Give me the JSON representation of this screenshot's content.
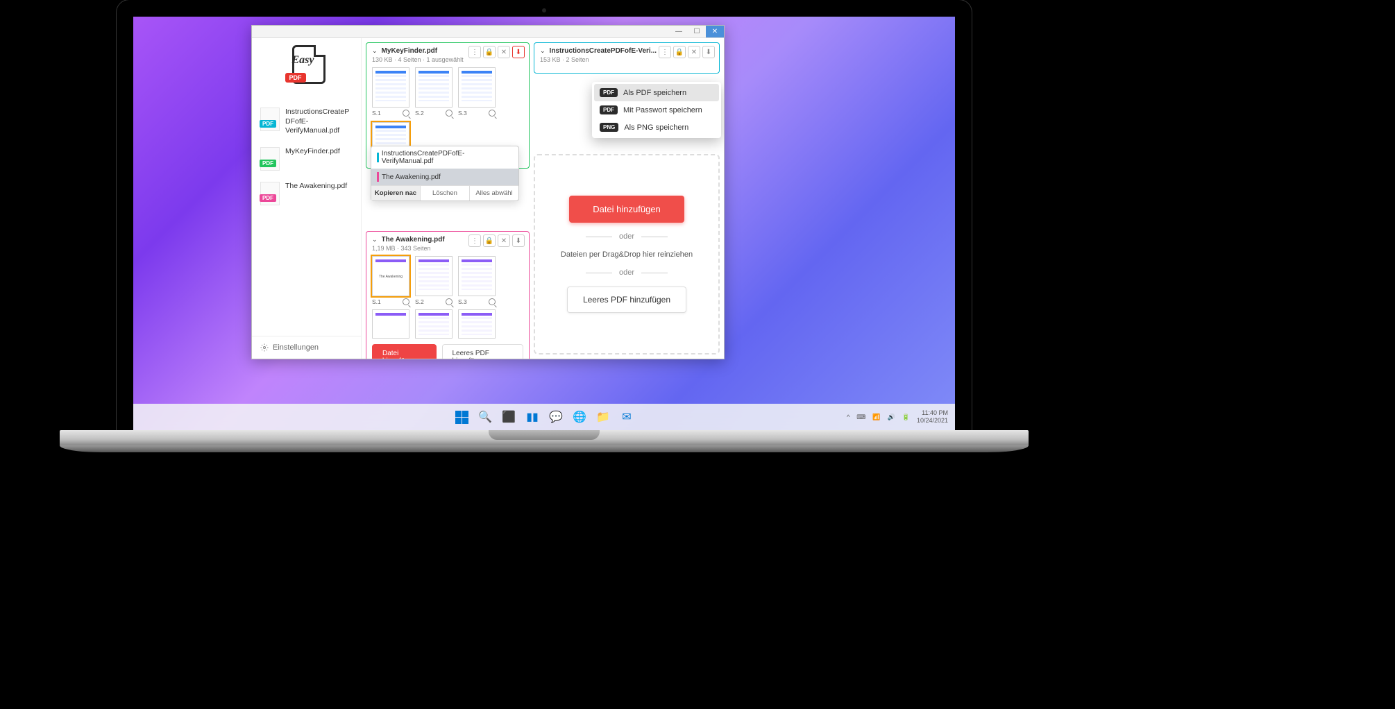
{
  "app": {
    "name": "Easy PDF",
    "logo_badge": "PDF",
    "settings_label": "Einstellungen"
  },
  "window_controls": {
    "min": "—",
    "max": "☐",
    "close": "✕"
  },
  "sidebar_files": [
    {
      "name": "InstructionsCreatePDFofE-VerifyManual.pdf",
      "badge": "PDF",
      "color": "cyan"
    },
    {
      "name": "MyKeyFinder.pdf",
      "badge": "PDF",
      "color": "green"
    },
    {
      "name": "The Awakening.pdf",
      "badge": "PDF",
      "color": "pink"
    }
  ],
  "groups": {
    "mykeyfinder": {
      "title": "MyKeyFinder.pdf",
      "meta": "130 KB ·  4 Seiten  ·  1 ausgewählt",
      "pages": [
        "S.1",
        "S.2",
        "S.3"
      ]
    },
    "awakening": {
      "title": "The Awakening.pdf",
      "meta": "1,19 MB ·  343 Seiten",
      "pages": [
        "S.1",
        "S.2",
        "S.3"
      ]
    },
    "instructions": {
      "title": "InstructionsCreatePDFofE-Veri...",
      "meta": "153 KB ·  2 Seiten"
    }
  },
  "drag": {
    "item1": "InstructionsCreatePDFofE-VerifyManual.pdf",
    "item2": "The Awakening.pdf",
    "btn_copy": "Kopieren nac",
    "btn_delete": "Löschen",
    "btn_deselect": "Alles abwähl"
  },
  "dropdown": {
    "save_pdf": "Als PDF speichern",
    "save_pw": "Mit Passwort speichern",
    "save_png": "Als PNG speichern",
    "badge_pdf": "PDF",
    "badge_png": "PNG"
  },
  "buttons": {
    "add_file": "Datei hinzufügen",
    "add_empty": "Leeres PDF hinzufügen",
    "or": "oder",
    "dragdrop": "Dateien per Drag&Drop hier reinziehen"
  },
  "taskbar": {
    "time": "11:40 PM",
    "date": "10/24/2021"
  }
}
